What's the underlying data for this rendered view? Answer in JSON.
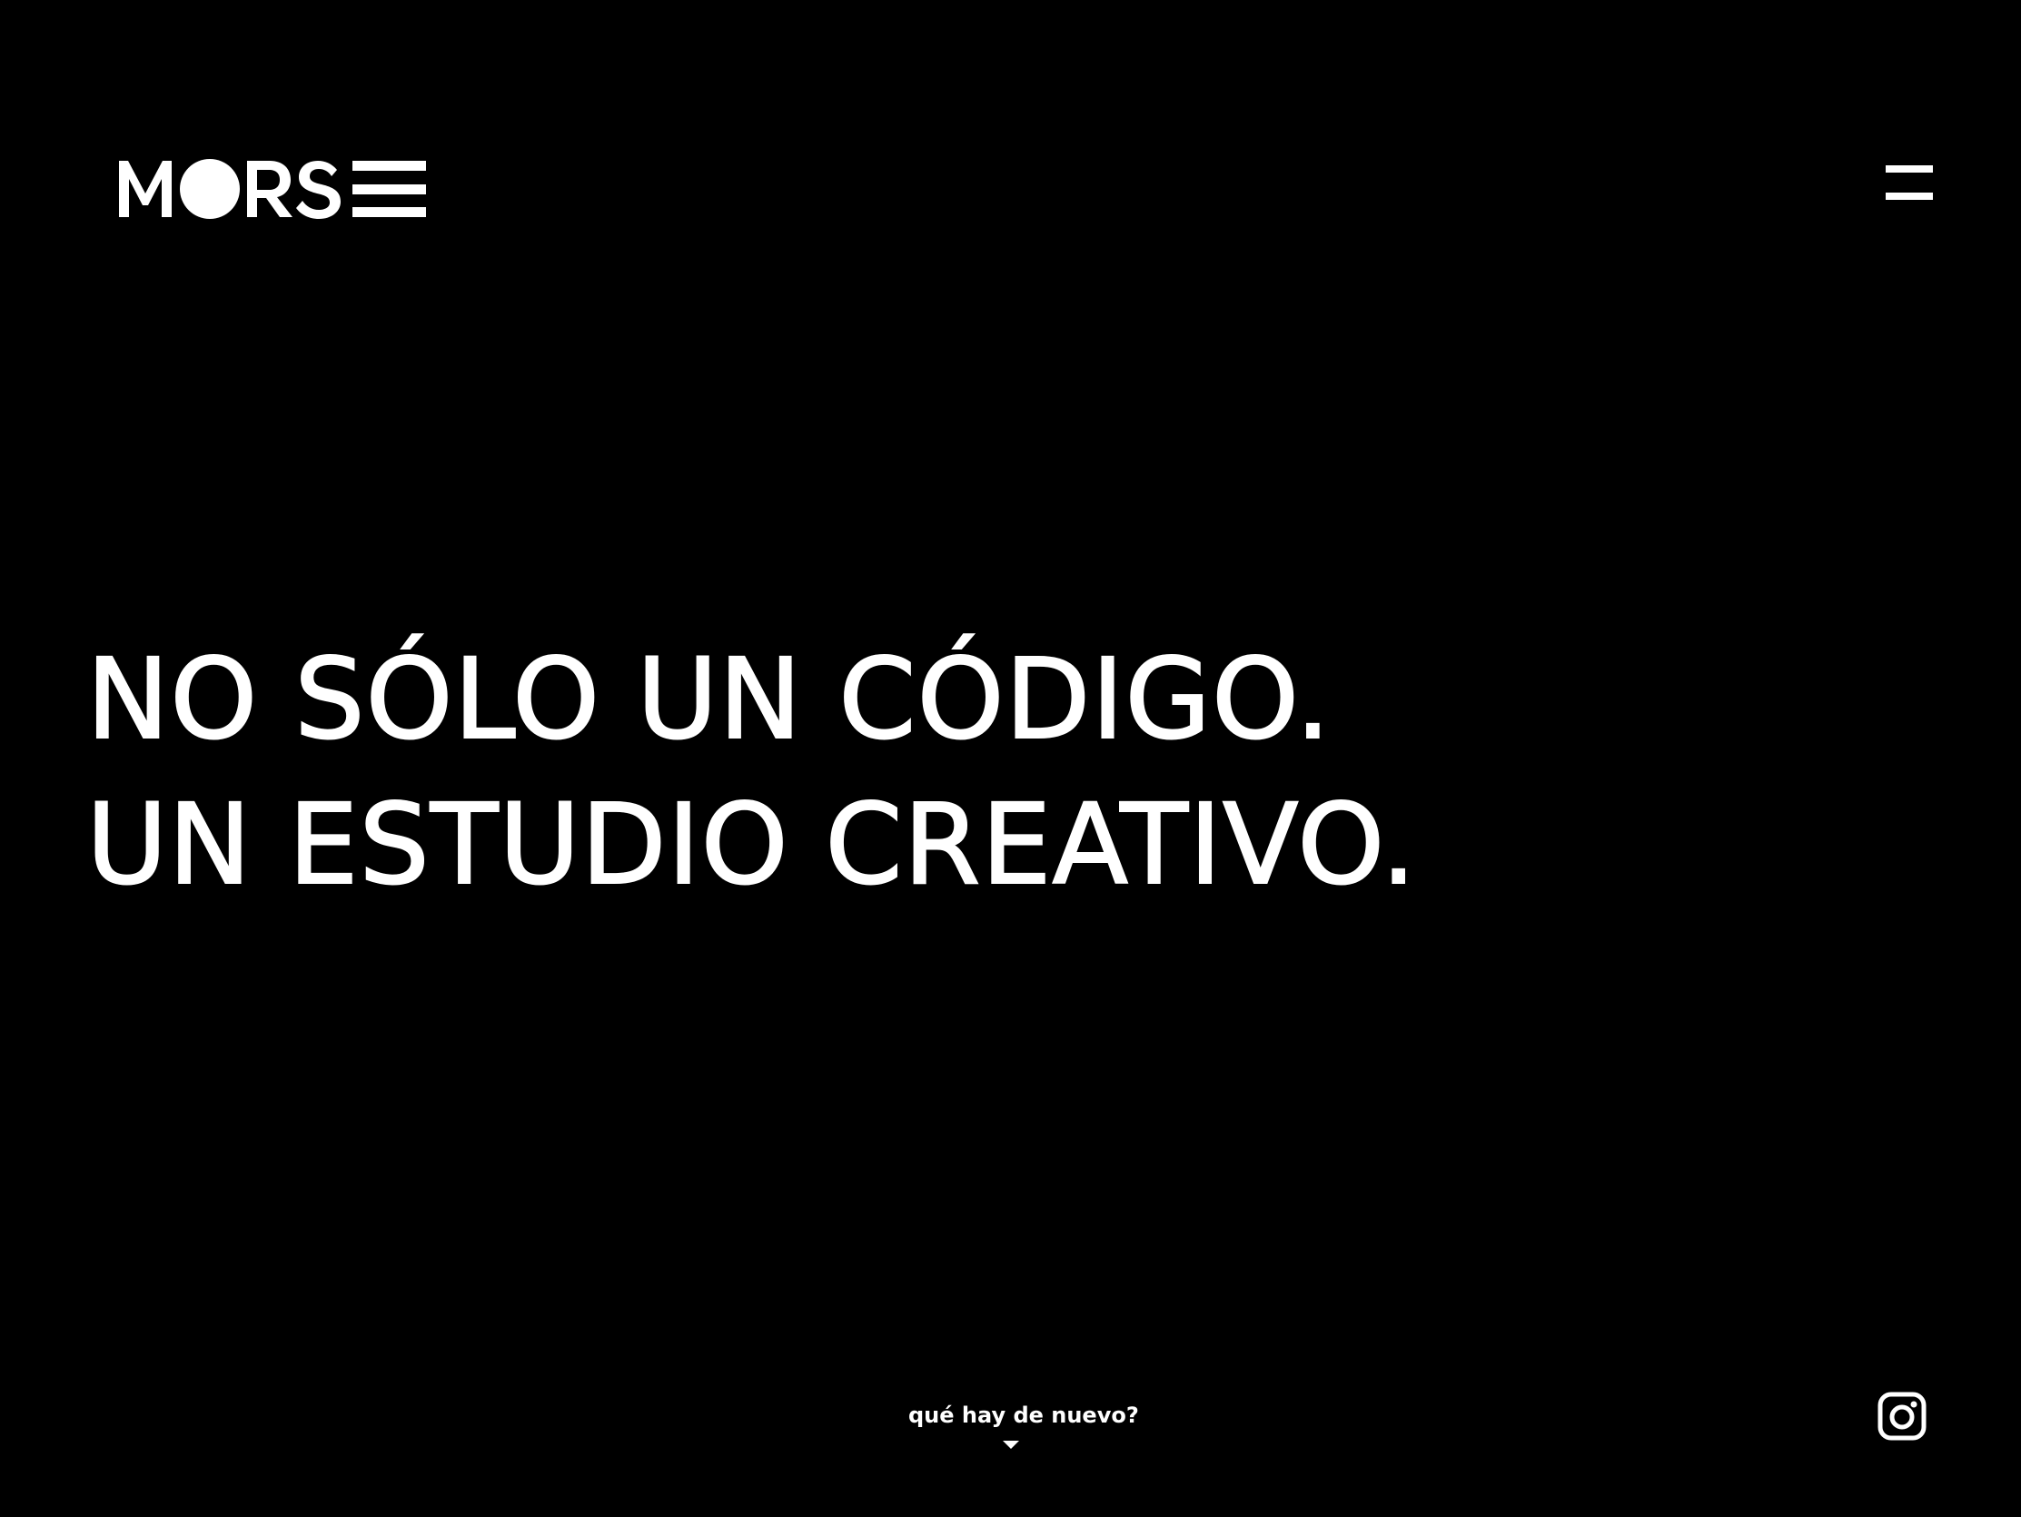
{
  "header": {
    "logo_text": "MORSE",
    "menu_icon": "hamburger-menu-icon"
  },
  "hero": {
    "line1": "NO SÓLO UN CÓDIGO.",
    "line2": "UN ESTUDIO CREATIVO."
  },
  "footer": {
    "news_link_label": "qué hay de nuevo?",
    "news_arrow_icon": "caret-down-icon",
    "social_icon": "instagram-icon"
  },
  "colors": {
    "background": "#000000",
    "foreground": "#ffffff"
  }
}
